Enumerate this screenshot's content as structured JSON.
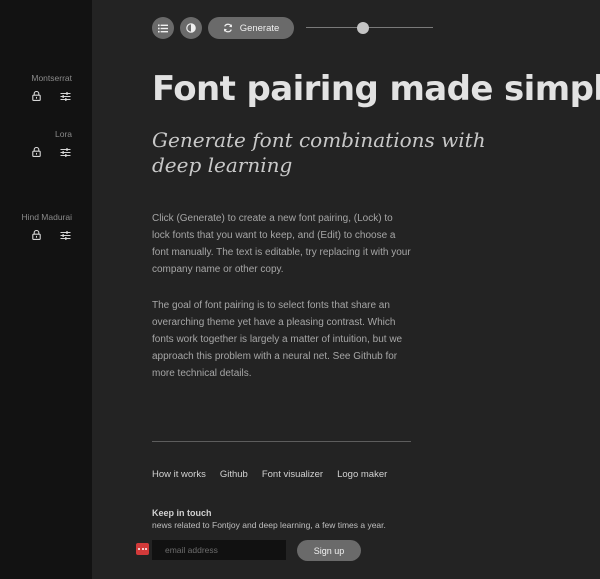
{
  "sidebar": {
    "fonts": [
      {
        "name": "Montserrat",
        "lock_icon": "lock-icon",
        "edit_icon": "sliders-icon"
      },
      {
        "name": "Lora",
        "lock_icon": "lock-icon",
        "edit_icon": "sliders-icon"
      },
      {
        "name": "Hind Madurai",
        "lock_icon": "lock-icon",
        "edit_icon": "sliders-icon"
      }
    ]
  },
  "toolbar": {
    "list_icon": "list-icon",
    "theme_icon": "contrast-icon",
    "generate_icon": "refresh-icon",
    "generate_label": "Generate",
    "slider_value": 0.45
  },
  "main": {
    "headline": "Font pairing made simple",
    "subheadline": "Generate font combinations with deep learning",
    "paragraph1": "Click (Generate) to create a new font pairing, (Lock) to lock fonts that you want to keep, and (Edit) to choose a font manually. The text is editable, try replacing it with your company name or other copy.",
    "paragraph2": "The goal of font pairing is to select fonts that share an overarching theme yet have a pleasing contrast. Which fonts work together is largely a matter of intuition, but we approach this problem with a neural net. See Github for more technical details."
  },
  "footer": {
    "links": [
      "How it works",
      "Github",
      "Font visualizer",
      "Logo maker"
    ],
    "keep_title": "Keep in touch",
    "keep_text": "news related to Fontjoy and deep learning, a few times a year.",
    "email_placeholder": "email address",
    "signup_label": "Sign up"
  },
  "colors": {
    "background": "#232323",
    "sidebar": "#121212",
    "button": "#6a6a6a",
    "email_badge": "#d23a3a"
  }
}
